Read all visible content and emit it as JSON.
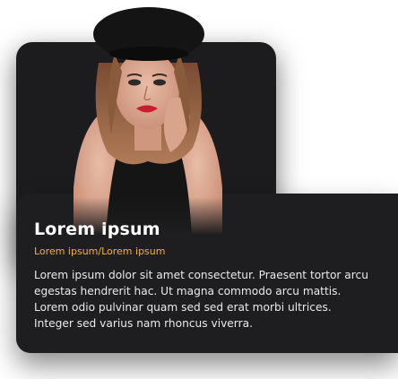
{
  "card": {
    "title": "Lorem ipsum",
    "subtitle": "Lorem ipsum/Lorem ipsum",
    "description": "Lorem ipsum dolor sit amet consectetur. Praesent tortor arcu egestas hendrerit hac. Ut magna commodo arcu mattis. Lorem odio pulvinar quam sed sed erat morbi ultrices. Integer sed varius nam rhoncus viverra."
  },
  "colors": {
    "card_background": "#1e1e20",
    "title": "#ffffff",
    "subtitle_accent": "#f2b233",
    "body_text": "#eaeaea"
  },
  "image": {
    "subject": "portrait-photo"
  }
}
